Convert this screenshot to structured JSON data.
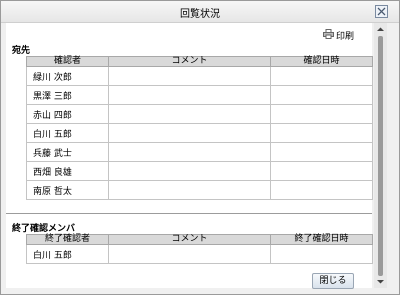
{
  "dialog": {
    "title": "回覧状況"
  },
  "toolbar": {
    "print_label": "印刷"
  },
  "recipients": {
    "label": "宛先",
    "columns": [
      "確認者",
      "コメント",
      "確認日時"
    ],
    "rows": [
      {
        "name": "緑川 次郎",
        "comment": "",
        "date": ""
      },
      {
        "name": "黒澤 三郎",
        "comment": "",
        "date": ""
      },
      {
        "name": "赤山 四郎",
        "comment": "",
        "date": ""
      },
      {
        "name": "白川 五郎",
        "comment": "",
        "date": ""
      },
      {
        "name": "兵藤 武士",
        "comment": "",
        "date": ""
      },
      {
        "name": "西畑 良雄",
        "comment": "",
        "date": ""
      },
      {
        "name": "南原 哲太",
        "comment": "",
        "date": ""
      }
    ]
  },
  "finished": {
    "label": "終了確認メンバ",
    "columns": [
      "終了確認者",
      "コメント",
      "終了確認日時"
    ],
    "rows": [
      {
        "name": "白川 五郎",
        "comment": "",
        "date": ""
      }
    ]
  },
  "footer": {
    "close_label": "閉じる"
  }
}
